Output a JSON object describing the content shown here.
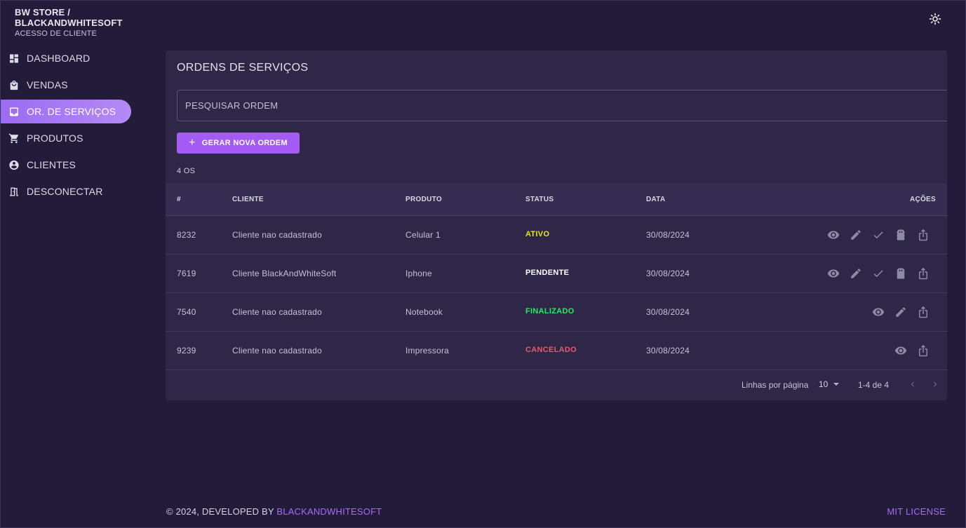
{
  "brand": {
    "line1": "BW STORE /",
    "line2": "BLACKANDWHITESOFT",
    "subtitle": "ACESSO DE CLIENTE"
  },
  "sidebar": {
    "items": [
      {
        "label": "DASHBOARD",
        "icon": "dashboard-icon"
      },
      {
        "label": "VENDAS",
        "icon": "shopping-bag-icon"
      },
      {
        "label": "OR. DE SERVIÇOS",
        "icon": "inbox-tray-icon",
        "active": true
      },
      {
        "label": "PRODUTOS",
        "icon": "shopping-cart-icon"
      },
      {
        "label": "CLIENTES",
        "icon": "account-circle-icon"
      },
      {
        "label": "DESCONECTAR",
        "icon": "door-exit-icon"
      }
    ]
  },
  "header": {
    "theme_icon": "sun-brightness-icon"
  },
  "main": {
    "title": "ORDENS DE SERVIÇOS",
    "search_placeholder": "PESQUISAR ORDEM",
    "new_button": "GERAR NOVA ORDEM",
    "count": "4 OS",
    "columns": [
      "#",
      "CLIENTE",
      "PRODUTO",
      "STATUS",
      "DATA",
      "AÇÕES"
    ],
    "rows": [
      {
        "id": "8232",
        "client": "Cliente nao cadastrado",
        "product": "Celular 1",
        "status": "ATIVO",
        "status_color": "#e5e52a",
        "date": "30/08/2024",
        "actions": [
          "eye-icon",
          "pencil-icon",
          "check-icon",
          "delete-icon",
          "share-icon"
        ]
      },
      {
        "id": "7619",
        "client": "Cliente BlackAndWhiteSoft",
        "product": "Iphone",
        "status": "PENDENTE",
        "status_color": "#ffffff",
        "date": "30/08/2024",
        "actions": [
          "eye-icon",
          "pencil-icon",
          "check-icon",
          "delete-icon",
          "share-icon"
        ]
      },
      {
        "id": "7540",
        "client": "Cliente nao cadastrado",
        "product": "Notebook",
        "status": "FINALIZADO",
        "status_color": "#2ee86a",
        "date": "30/08/2024",
        "actions": [
          "eye-icon",
          "pencil-icon",
          "share-icon"
        ]
      },
      {
        "id": "9239",
        "client": "Cliente nao cadastrado",
        "product": "Impressora",
        "status": "CANCELADO",
        "status_color": "#f2556b",
        "date": "30/08/2024",
        "actions": [
          "eye-icon",
          "share-icon"
        ]
      }
    ],
    "pagination": {
      "rows_label": "Linhas por página",
      "rows_value": "10",
      "range": "1-4 de 4"
    }
  },
  "footer": {
    "left_prefix": "© 2024, DEVELOPED BY ",
    "left_link": "BLACKANDWHITESOFT",
    "right": "MIT LICENSE"
  },
  "colors": {
    "background": "#221c3a",
    "card": "#2e2748",
    "accent": "#a35bf4",
    "link": "#a56cf5"
  }
}
